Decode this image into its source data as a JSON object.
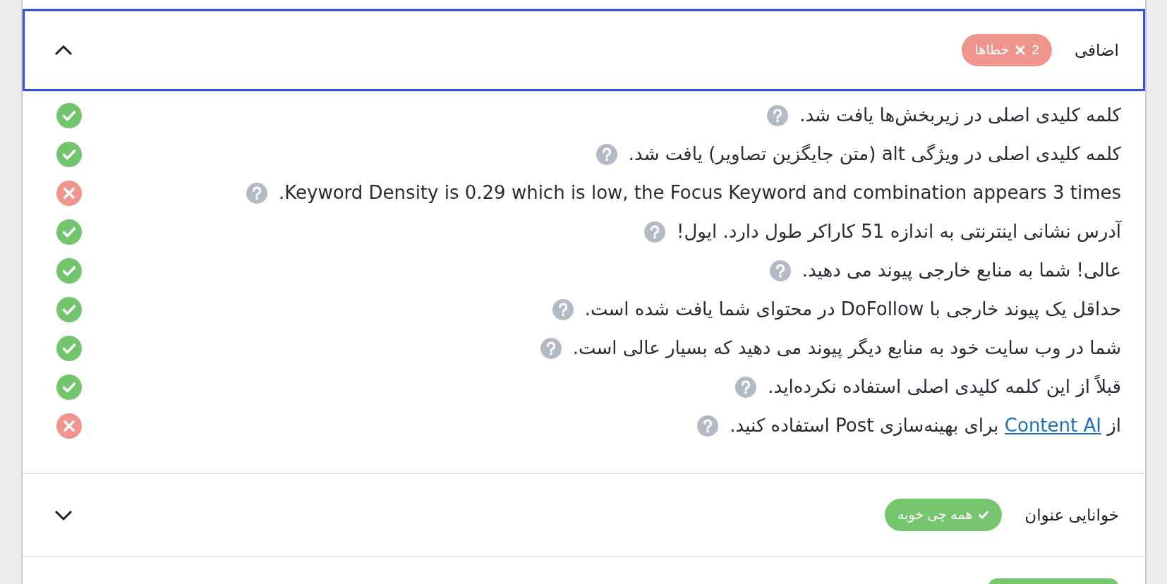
{
  "sections": [
    {
      "title": "اضافی",
      "expanded": true,
      "focused": true,
      "badge": {
        "kind": "error",
        "count": "2",
        "label": "خطاها"
      },
      "items": [
        {
          "text": "کلمه کلیدی اصلی در زیربخش‌ها یافت شد.",
          "passed": true
        },
        {
          "text": "کلمه کلیدی اصلی در ویژگی alt (متن جایگزین تصاویر) یافت شد.",
          "passed": true
        },
        {
          "text": "Keyword Density is 0.29 which is low, the Focus Keyword and combination appears 3 times.",
          "passed": false
        },
        {
          "text": "آدرس نشانی اینترنتی به اندازه 51 کاراکر طول دارد. ایول!",
          "passed": true
        },
        {
          "text": "عالی! شما به منابع خارجی پیوند می دهید.",
          "passed": true
        },
        {
          "text": "حداقل یک پیوند خارجی با DoFollow در محتوای شما یافت شده است.",
          "passed": true
        },
        {
          "text": "شما در وب سایت خود به منابع دیگر پیوند می دهید که بسیار عالی است.",
          "passed": true
        },
        {
          "text": "قبلاً از این کلمه کلیدی اصلی استفاده نکرده‌اید.",
          "passed": true
        },
        {
          "parts": [
            {
              "text": "از "
            },
            {
              "link": "Content AI"
            },
            {
              "text": " برای بهینه‌سازی Post استفاده کنید."
            }
          ],
          "passed": false
        }
      ]
    },
    {
      "title": "خوانایی عنوان",
      "expanded": false,
      "focused": false,
      "badge": {
        "kind": "good",
        "label": "همه چی خوبه"
      }
    },
    {
      "cut": true,
      "badge": {
        "kind": "good"
      }
    }
  ]
}
